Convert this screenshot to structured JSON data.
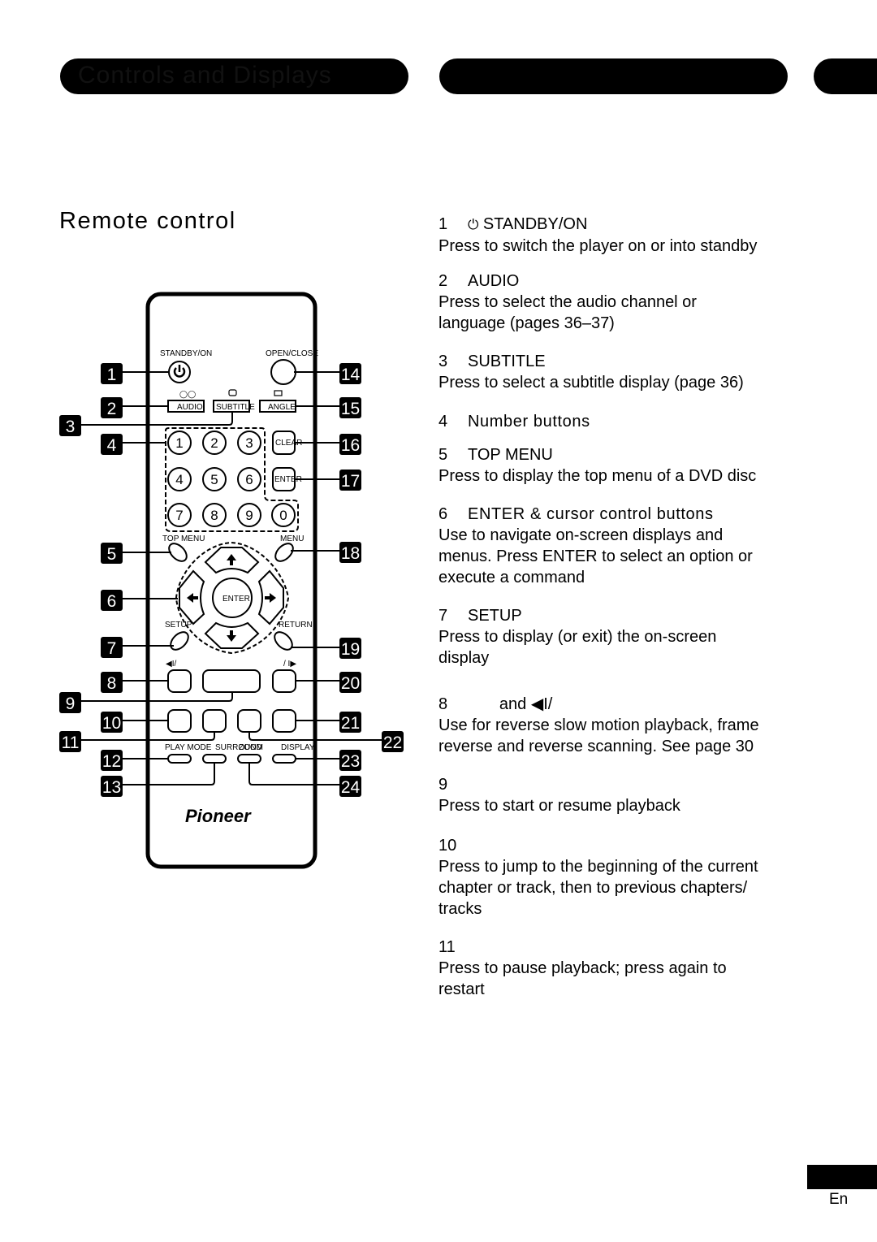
{
  "header": {
    "title": "Controls and Displays"
  },
  "section": {
    "title": "Remote control"
  },
  "items": [
    {
      "num": "1",
      "icon": "power-icon",
      "title": "STANDBY/ON",
      "desc": "Press to switch the player on or into standby"
    },
    {
      "num": "2",
      "title": "AUDIO",
      "desc": "Press to select the audio channel or\nlanguage (pages 36–37)"
    },
    {
      "num": "3",
      "title": "SUBTITLE",
      "desc": "Press to select a subtitle display (page 36)"
    },
    {
      "num": "4",
      "title": "Number buttons",
      "desc": ""
    },
    {
      "num": "5",
      "title": "TOP MENU",
      "desc": "Press to display the top menu of a DVD disc"
    },
    {
      "num": "6",
      "title": "ENTER & cursor control buttons",
      "desc": "Use to navigate on-screen displays and\nmenus. Press ENTER to select an option or\nexecute a command"
    },
    {
      "num": "7",
      "title": "SETUP",
      "desc": "Press to display (or exit) the on-screen\ndisplay"
    },
    {
      "num": "8",
      "title": "       and ◀I/",
      "desc": "Use for reverse slow motion playback, frame\nreverse and reverse scanning. See page 30"
    },
    {
      "num": "9",
      "title": "",
      "desc": "Press to start or resume playback"
    },
    {
      "num": "10",
      "title": "",
      "desc": "Press to jump to the beginning of the current\nchapter or track, then to previous chapters/\ntracks"
    },
    {
      "num": "11",
      "title": "",
      "desc": "Press to pause playback; press again to\nrestart"
    }
  ],
  "remote": {
    "labels": {
      "standby": "STANDBY/ON",
      "open_close": "OPEN/CLOSE",
      "audio": "AUDIO",
      "subtitle": "SUBTITLE",
      "angle": "ANGLE",
      "clear": "CLEAR",
      "enter_side": "ENTER",
      "top_menu": "TOP MENU",
      "menu": "MENU",
      "enter_center": "ENTER",
      "setup": "SETUP",
      "return": "RETURN",
      "slow_rev": "◀I/",
      "slow_fwd": "/ I▶",
      "play_mode": "PLAY MODE",
      "surround": "SURROUND",
      "zoom": "ZOOM",
      "display": "DISPLAY",
      "brand": "Pioneer"
    },
    "digits": [
      "1",
      "2",
      "3",
      "4",
      "5",
      "6",
      "7",
      "8",
      "9",
      "0"
    ],
    "callouts": [
      "1",
      "2",
      "3",
      "4",
      "5",
      "6",
      "7",
      "8",
      "9",
      "10",
      "11",
      "12",
      "13",
      "14",
      "15",
      "16",
      "17",
      "18",
      "19",
      "20",
      "21",
      "22",
      "23",
      "24"
    ]
  },
  "footer": {
    "lang": "En"
  }
}
